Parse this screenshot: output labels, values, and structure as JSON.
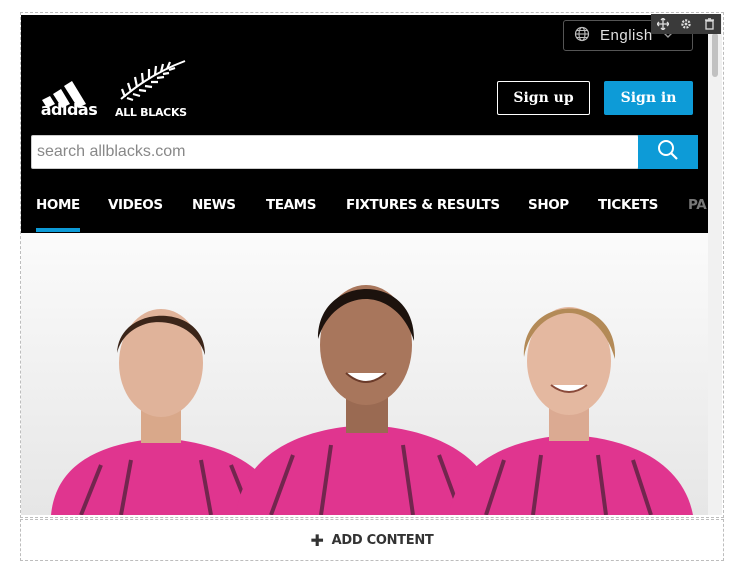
{
  "header": {
    "language": "English",
    "signup_label": "Sign up",
    "signin_label": "Sign in",
    "search_placeholder": "search allblacks.com",
    "logo_adidas": "adidas",
    "logo_allblacks": "ALL BLACKS"
  },
  "nav": {
    "items": [
      {
        "label": "HOME",
        "active": true
      },
      {
        "label": "VIDEOS"
      },
      {
        "label": "NEWS"
      },
      {
        "label": "TEAMS"
      },
      {
        "label": "FIXTURES & RESULTS"
      },
      {
        "label": "SHOP"
      },
      {
        "label": "TICKETS"
      },
      {
        "label": "PA"
      }
    ]
  },
  "editor": {
    "add_content_label": "ADD CONTENT",
    "tools": [
      "move-icon",
      "gear-icon",
      "trash-icon"
    ]
  },
  "colors": {
    "accent": "#0d9bd7",
    "jersey": "#e0358f"
  }
}
